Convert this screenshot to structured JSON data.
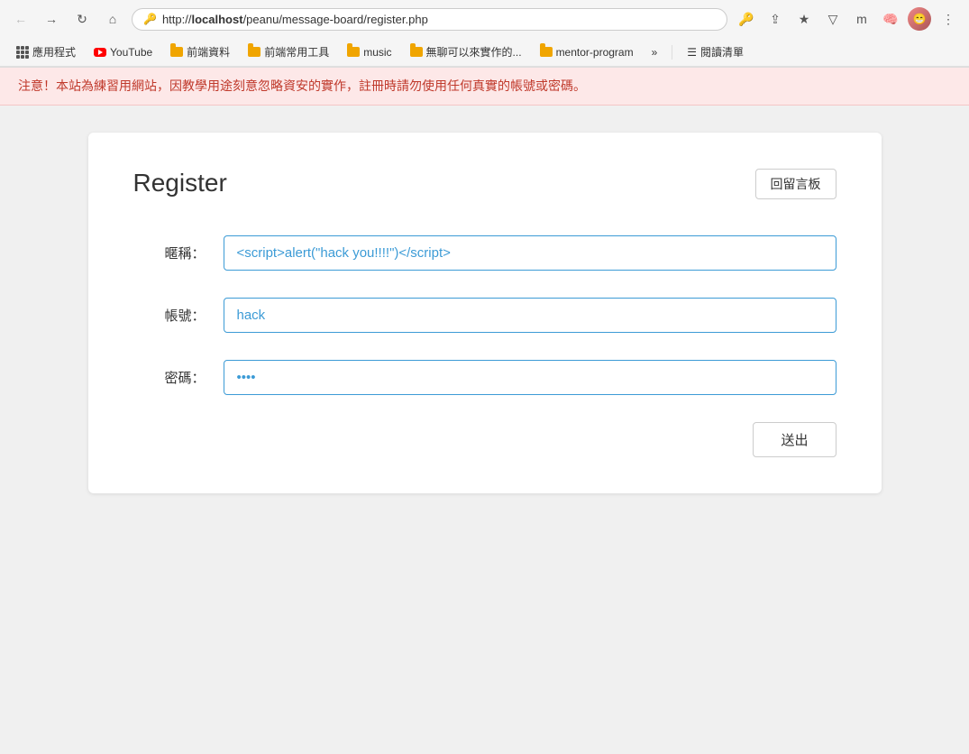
{
  "browser": {
    "url": "http://localhost/peanu/message-board/register.php",
    "url_protocol": "http://",
    "url_bold": "localhost",
    "url_path": "/peanu/message-board/register.php"
  },
  "bookmarks": {
    "apps_label": "應用程式",
    "items": [
      {
        "id": "youtube",
        "label": "YouTube",
        "type": "youtube"
      },
      {
        "id": "frontend-data",
        "label": "前端資料",
        "type": "folder"
      },
      {
        "id": "frontend-tools",
        "label": "前端常用工具",
        "type": "folder"
      },
      {
        "id": "music",
        "label": "music",
        "type": "folder"
      },
      {
        "id": "boring",
        "label": "無聊可以來實作的...",
        "type": "folder"
      },
      {
        "id": "mentor",
        "label": "mentor-program",
        "type": "folder"
      }
    ],
    "more_label": "»",
    "reading_list_label": "閱讀清單"
  },
  "warning": {
    "text": "注意！本站為練習用網站，因教學用途刻意忽略資安的實作，註冊時請勿使用任何真實的帳號或密碼。"
  },
  "register": {
    "title": "Register",
    "back_button": "回留言板",
    "fields": {
      "nickname_label": "暱稱：",
      "nickname_value": "<script>alert(\"hack you!!!!\")</script>",
      "account_label": "帳號：",
      "account_value": "hack",
      "password_label": "密碼：",
      "password_value": "••••"
    },
    "submit_label": "送出"
  }
}
